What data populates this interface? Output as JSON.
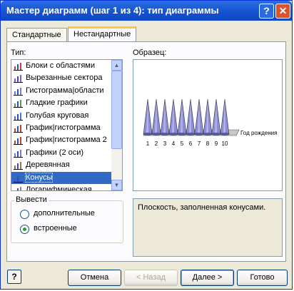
{
  "window": {
    "title": "Мастер диаграмм (шаг 1 из 4): тип диаграммы",
    "help_glyph": "?",
    "close_glyph": "✕"
  },
  "tabs": [
    {
      "label": "Стандартные"
    },
    {
      "label": "Нестандартные"
    }
  ],
  "types_label": "Тип:",
  "chart_types": [
    {
      "label": "Блоки с областями",
      "icon": "area-blocks-icon"
    },
    {
      "label": "Вырезанные сектора",
      "icon": "exploded-pie-icon"
    },
    {
      "label": "Гистограмма|области",
      "icon": "column-area-icon"
    },
    {
      "label": "Гладкие графики",
      "icon": "smooth-line-icon"
    },
    {
      "label": "Голубая круговая",
      "icon": "blue-pie-icon"
    },
    {
      "label": "График|гистограмма",
      "icon": "line-column-icon"
    },
    {
      "label": "График|гистограмма 2",
      "icon": "line-column-2-icon"
    },
    {
      "label": "Графики (2 оси)",
      "icon": "two-axes-icon"
    },
    {
      "label": "Деревянная",
      "icon": "wooden-icon"
    },
    {
      "label": "Конусы",
      "icon": "cones-icon",
      "selected": true
    },
    {
      "label": "Логарифмическая",
      "icon": "log-icon"
    }
  ],
  "sample_label": "Образец:",
  "chart_data": {
    "type": "bar",
    "categories": [
      "1",
      "2",
      "3",
      "4",
      "5",
      "6",
      "7",
      "8",
      "9",
      "10"
    ],
    "values": [
      1,
      1,
      1,
      1,
      1,
      1,
      1,
      1,
      1,
      1
    ],
    "xlabel": "Год рождения",
    "ylim": [
      0,
      1
    ]
  },
  "description": "Плоскость, заполненная конусами.",
  "from_group": {
    "label": "Вывести",
    "options": [
      {
        "label": "дополнительные",
        "checked": false
      },
      {
        "label": "встроенные",
        "checked": true
      }
    ]
  },
  "buttons": {
    "help": "?",
    "cancel": "Отмена",
    "back": "< Назад",
    "next": "Далее >",
    "finish": "Готово"
  },
  "colors": {
    "cone_fill": "#8c8cd8",
    "selection": "#316ac5",
    "title_bar": "#1553d0"
  }
}
